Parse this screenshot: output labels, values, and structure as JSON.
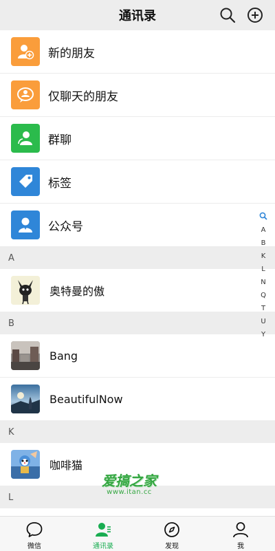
{
  "header": {
    "title": "通讯录",
    "search_icon": "search-icon",
    "add_icon": "plus-circle-icon"
  },
  "fixed_items": [
    {
      "label": "新的朋友",
      "icon": "add-user-icon",
      "color": "#fa9d3b"
    },
    {
      "label": "仅聊天的朋友",
      "icon": "chat-user-icon",
      "color": "#fa9d3b"
    },
    {
      "label": "群聊",
      "icon": "group-icon",
      "color": "#2bbb4c"
    },
    {
      "label": "标签",
      "icon": "tag-icon",
      "color": "#2f86d8"
    },
    {
      "label": "公众号",
      "icon": "official-account-icon",
      "color": "#2f86d8"
    }
  ],
  "sections": [
    {
      "letter": "A",
      "contacts": [
        {
          "name": "奥特曼的傲"
        }
      ]
    },
    {
      "letter": "B",
      "contacts": [
        {
          "name": "Bang"
        },
        {
          "name": "BeautifulNow"
        }
      ]
    },
    {
      "letter": "K",
      "contacts": [
        {
          "name": "咖啡猫"
        }
      ]
    },
    {
      "letter": "L",
      "contacts": []
    }
  ],
  "alpha_index": [
    "A",
    "B",
    "K",
    "L",
    "N",
    "Q",
    "T",
    "U",
    "Y"
  ],
  "watermark": {
    "line1": "爱搞之家",
    "line2": "www.itan.cc"
  },
  "tabbar": {
    "items": [
      {
        "label": "微信",
        "icon": "chat-bubble-icon"
      },
      {
        "label": "通讯录",
        "icon": "contacts-icon",
        "active": true
      },
      {
        "label": "发现",
        "icon": "compass-icon"
      },
      {
        "label": "我",
        "icon": "person-icon"
      }
    ],
    "active_color": "#19ad51"
  }
}
